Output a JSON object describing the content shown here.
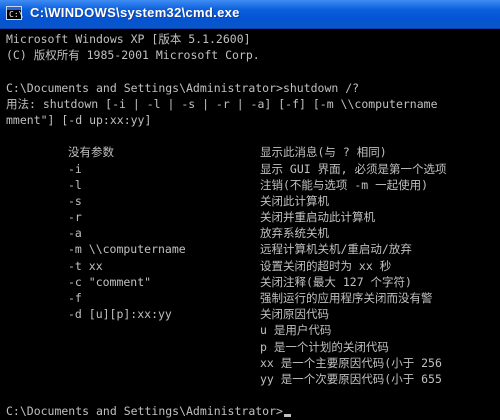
{
  "window": {
    "title": "C:\\WINDOWS\\system32\\cmd.exe",
    "icon": "cmd-icon",
    "icon_glyph": "C:\\"
  },
  "console": {
    "header": [
      "Microsoft Windows XP [版本 5.1.2600]",
      "(C) 版权所有 1985-2001 Microsoft Corp."
    ],
    "command_line": "C:\\Documents and Settings\\Administrator>shutdown /?",
    "usage": [
      "用法: shutdown [-i | -l | -s | -r | -a] [-f] [-m \\\\computername",
      "mment\"] [-d up:xx:yy]"
    ],
    "options": [
      {
        "opt": "没有参数",
        "desc": "显示此消息(与 ? 相同)"
      },
      {
        "opt": "-i",
        "desc": "显示 GUI 界面, 必须是第一个选项"
      },
      {
        "opt": "-l",
        "desc": "注销(不能与选项 -m 一起使用)"
      },
      {
        "opt": "-s",
        "desc": "关闭此计算机"
      },
      {
        "opt": "-r",
        "desc": "关闭并重启动此计算机"
      },
      {
        "opt": "-a",
        "desc": "放弃系统关机"
      },
      {
        "opt": "-m \\\\computername",
        "desc": "远程计算机关机/重启动/放弃"
      },
      {
        "opt": "-t xx",
        "desc": "设置关闭的超时为 xx 秒"
      },
      {
        "opt": "-c \"comment\"",
        "desc": "关闭注释(最大 127 个字符)"
      },
      {
        "opt": "-f",
        "desc": "强制运行的应用程序关闭而没有警"
      },
      {
        "opt": "-d [u][p]:xx:yy",
        "desc": "关闭原因代码"
      },
      {
        "opt": "",
        "desc": "u 是用户代码"
      },
      {
        "opt": "",
        "desc": "p 是一个计划的关闭代码"
      },
      {
        "opt": "",
        "desc": "xx 是一个主要原因代码(小于 256"
      },
      {
        "opt": "",
        "desc": "yy 是一个次要原因代码(小于 655"
      }
    ],
    "prompt": "C:\\Documents and Settings\\Administrator>"
  },
  "colors": {
    "background": "#000000",
    "text": "#c0c0c0",
    "titlebar": "#0453d3"
  }
}
